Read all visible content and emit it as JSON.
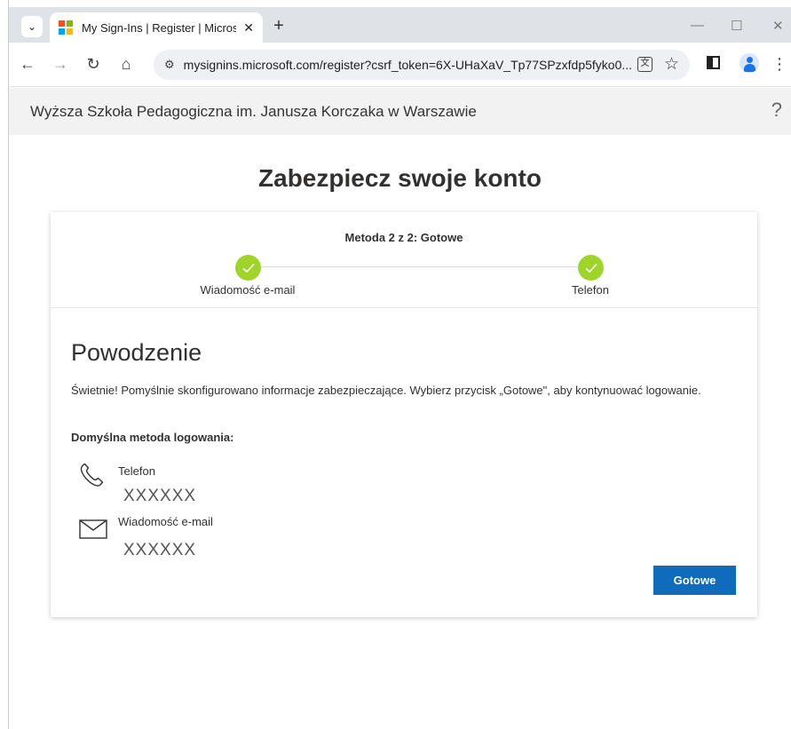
{
  "browser": {
    "tab": {
      "title": "My Sign-Ins | Register | Microsoft",
      "close_glyph": "✕"
    },
    "tab_search_glyph": "⌄",
    "new_tab_glyph": "+",
    "window_controls": {
      "minimize": "—",
      "maximize": "☐",
      "close": "✕"
    },
    "nav": {
      "back": "←",
      "forward": "→",
      "reload": "↻",
      "home": "⌂"
    },
    "address_bar": {
      "site_info_glyph": "⚙",
      "url": "mysignins.microsoft.com/register?csrf_token=6X-UHaXaV_Tp77SPzxfdp5fyko0..."
    },
    "translate_glyph": "文",
    "bookmark_glyph": "☆",
    "menu_glyph": "⋮"
  },
  "org": {
    "name": "Wyższa Szkoła Pedagogiczna im. Janusza Korczaka w Warszawie",
    "help": "?"
  },
  "page": {
    "title": "Zabezpiecz swoje konto"
  },
  "stepper": {
    "heading": "Metoda 2 z 2: Gotowe",
    "steps": [
      {
        "label": "Wiadomość e-mail",
        "status": "complete"
      },
      {
        "label": "Telefon",
        "status": "complete"
      }
    ],
    "complete_color": "#9fd42b"
  },
  "result": {
    "title": "Powodzenie",
    "message": "Świetnie! Pomyślnie skonfigurowano informacje zabezpieczające. Wybierz przycisk „Gotowe\", aby kontynuować logowanie.",
    "default_method_label": "Domyślna metoda logowania:",
    "methods": [
      {
        "icon": "phone-icon",
        "type": "Telefon",
        "value": "XXXXXX"
      },
      {
        "icon": "mail-icon",
        "type": "Wiadomość e-mail",
        "value": "XXXXXX"
      }
    ],
    "done_button": "Gotowe",
    "accent_color": "#0f6cbd"
  }
}
